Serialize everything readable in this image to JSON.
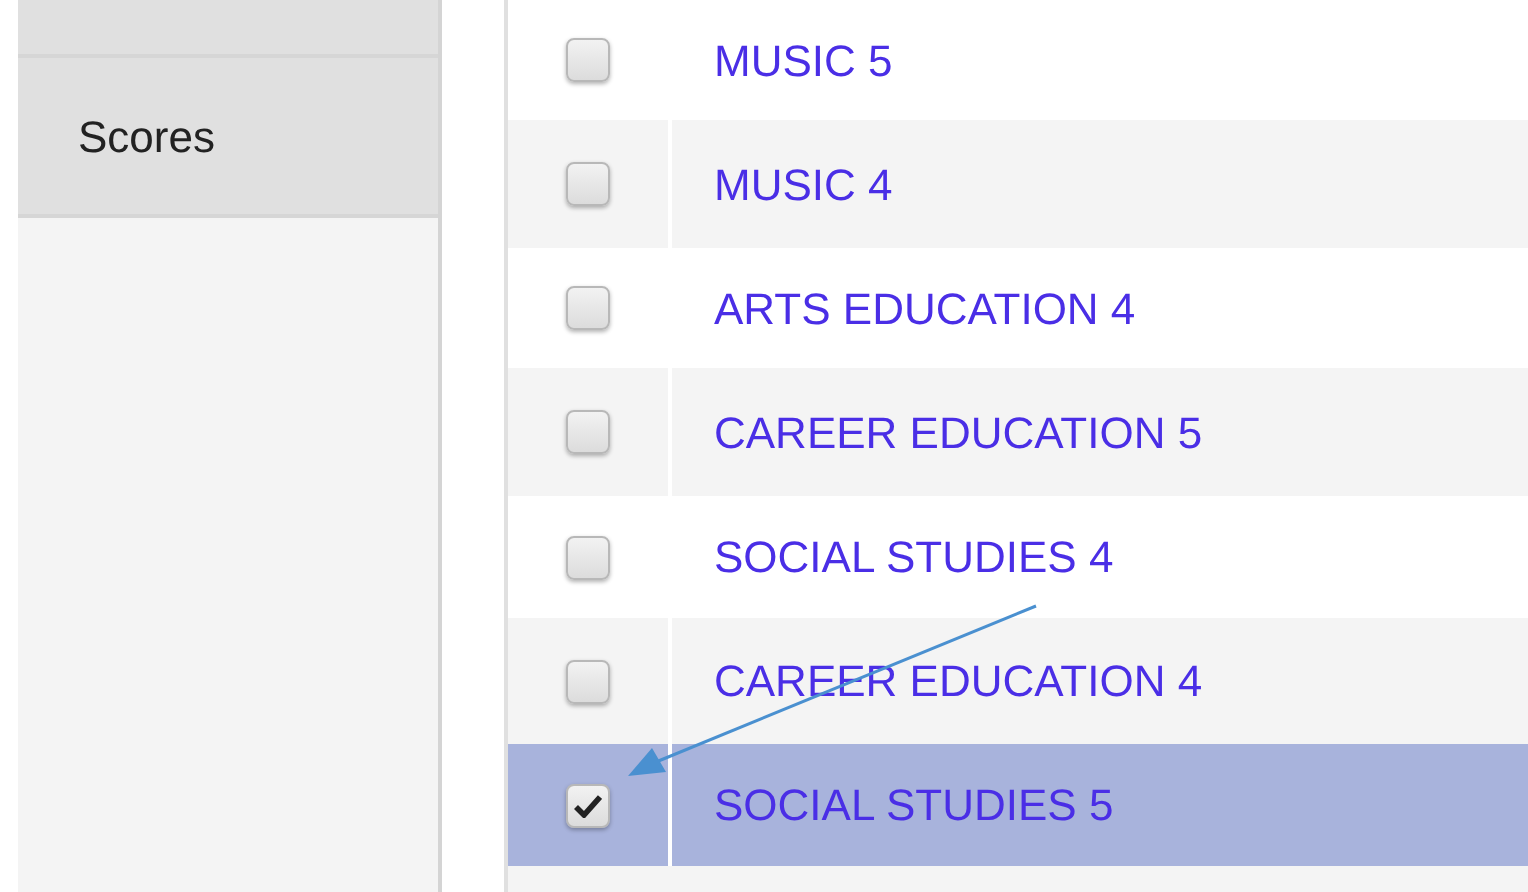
{
  "sidebar": {
    "items": [
      {
        "label": "Scores"
      }
    ]
  },
  "subjects": [
    {
      "label": "MUSIC 5",
      "checked": false,
      "selected": false
    },
    {
      "label": "MUSIC 4",
      "checked": false,
      "selected": false
    },
    {
      "label": "ARTS EDUCATION 4",
      "checked": false,
      "selected": false
    },
    {
      "label": "CAREER EDUCATION 5",
      "checked": false,
      "selected": false
    },
    {
      "label": "SOCIAL STUDIES 4",
      "checked": false,
      "selected": false
    },
    {
      "label": "CAREER EDUCATION 4",
      "checked": false,
      "selected": false
    },
    {
      "label": "SOCIAL STUDIES 5",
      "checked": true,
      "selected": true
    }
  ]
}
